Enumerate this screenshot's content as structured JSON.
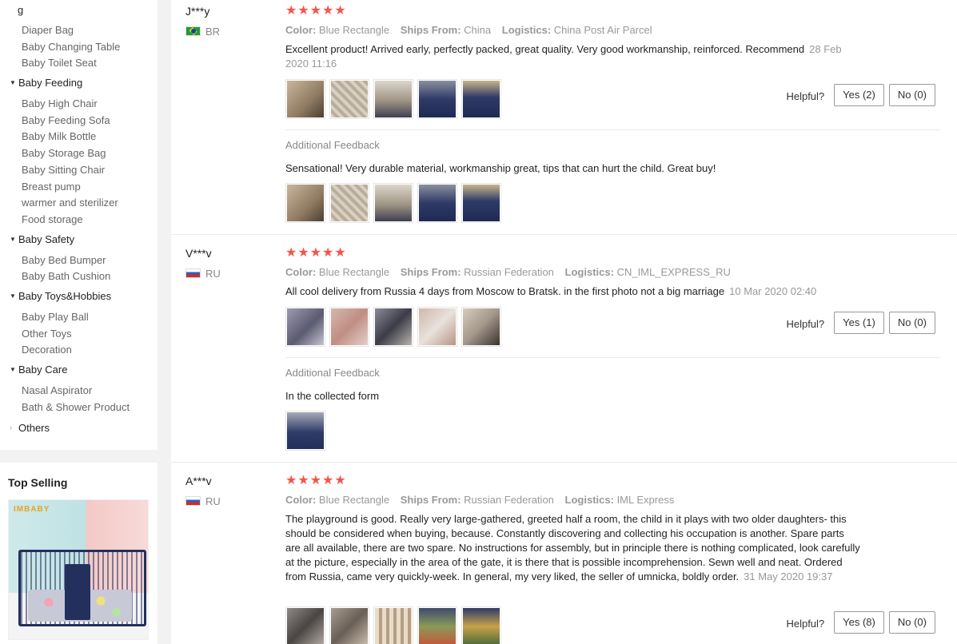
{
  "sidebar": {
    "top_cut_label": "g",
    "groups": [
      {
        "heading": null,
        "items": [
          "Diaper Bag",
          "Baby Changing Table",
          "Baby Toilet Seat"
        ]
      },
      {
        "heading": "Baby Feeding",
        "items": [
          "Baby High Chair",
          "Baby Feeding Sofa",
          "Baby Milk Bottle",
          "Baby Storage Bag",
          "Baby Sitting Chair",
          "Breast pump",
          "warmer and sterilizer",
          "Food storage"
        ]
      },
      {
        "heading": "Baby Safety",
        "items": [
          "Baby Bed Bumper",
          "Baby Bath Cushion"
        ]
      },
      {
        "heading": "Baby Toys&Hobbies",
        "items": [
          "Baby Play Ball",
          "Other Toys",
          "Decoration"
        ]
      },
      {
        "heading": "Baby Care",
        "items": [
          "Nasal Aspirator",
          "Bath & Shower Product"
        ]
      }
    ],
    "others_label": "Others",
    "top_selling_title": "Top Selling",
    "top_selling_brand": "IMBABY"
  },
  "reviews": [
    {
      "name": "J***y",
      "country": "BR",
      "stars": "★★★★★",
      "color_label": "Color:",
      "color_value": "Blue Rectangle",
      "ships_label": "Ships From:",
      "ships_value": "China",
      "logistics_label": "Logistics:",
      "logistics_value": "China Post Air Parcel",
      "text": "Excellent product! Arrived early, perfectly packed, great quality. Very good workmanship, reinforced. Recommend",
      "date": "28 Feb 2020 11:16",
      "helpful_label": "Helpful?",
      "yes_label": "Yes (2)",
      "no_label": "No (0)",
      "additional_label": "Additional Feedback",
      "additional_text": "Sensational! Very durable material, workmanship great, tips that can hurt the child. Great buy!"
    },
    {
      "name": "V***v",
      "country": "RU",
      "stars": "★★★★★",
      "color_label": "Color:",
      "color_value": "Blue Rectangle",
      "ships_label": "Ships From:",
      "ships_value": "Russian Federation",
      "logistics_label": "Logistics:",
      "logistics_value": "CN_IML_EXPRESS_RU",
      "text": "All cool delivery from Russia 4 days from Moscow to Bratsk. in the first photo not a big marriage",
      "date": "10 Mar 2020 02:40",
      "helpful_label": "Helpful?",
      "yes_label": "Yes (1)",
      "no_label": "No (0)",
      "additional_label": "Additional Feedback",
      "additional_text": "In the collected form"
    },
    {
      "name": "A***v",
      "country": "RU",
      "stars": "★★★★★",
      "color_label": "Color:",
      "color_value": "Blue Rectangle",
      "ships_label": "Ships From:",
      "ships_value": "Russian Federation",
      "logistics_label": "Logistics:",
      "logistics_value": "IML Express",
      "text": "The playground is good. Really very large-gathered, greeted half a room, the child in it plays with two older daughters- this should be considered when buying, because. Constantly discovering and collecting his occupation is another. Spare parts are all available, there are two spare. No instructions for assembly, but in principle there is nothing complicated, look carefully at the picture, especially in the area of the gate, it is there that is possible incomprehension. Sewn well and neat. Ordered from Russia, came very quickly-week. In general, my very liked, the seller of umnicka, boldly order.",
      "date": "31 May 2020 19:37",
      "helpful_label": "Helpful?",
      "yes_label": "Yes (8)",
      "no_label": "No (0)"
    }
  ],
  "colors": {
    "star": "#f1574b",
    "muted_text": "#999999",
    "page_bg": "#f2f2f2"
  }
}
